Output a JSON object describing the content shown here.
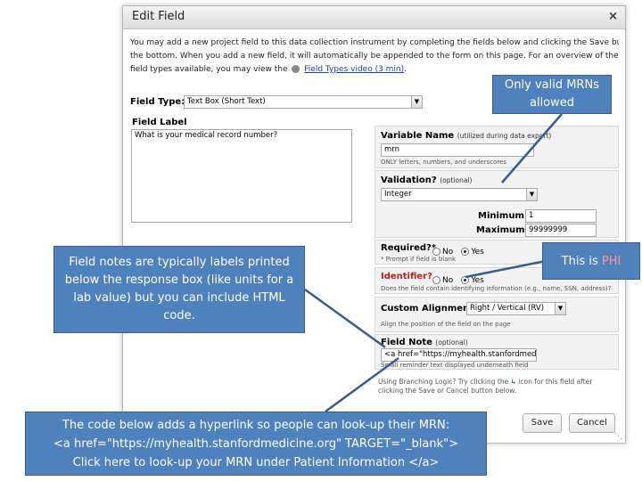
{
  "dialog": {
    "title": "Edit Field",
    "close_icon": "×",
    "intro_line1": "You may add a new project field to this data collection instrument by completing the fields below and clicking the Save button at",
    "intro_line2": "the bottom. When you add a new field, it will automatically be appended to the form on this page. For an overview of the different",
    "intro_line3_pre": "field types available, you may view the",
    "intro_link": "Field Types video (3 min)",
    "intro_line3_post": "."
  },
  "field_type": {
    "label": "Field Type:",
    "value": "Text Box (Short Text)"
  },
  "field_label": {
    "label": "Field Label",
    "value": "What is your medical record number?"
  },
  "variable_name": {
    "label": "Variable Name",
    "sublabel": "(utilized during data export)",
    "value": "mrn",
    "hint": "ONLY letters, numbers, and underscores"
  },
  "validation": {
    "label": "Validation?",
    "sublabel": "(optional)",
    "value": "Integer",
    "min_label": "Minimum:",
    "min_value": "1",
    "max_label": "Maximum:",
    "max_value": "99999999"
  },
  "required": {
    "label": "Required?*",
    "no": "No",
    "yes": "Yes",
    "hint": "* Prompt if field is blank"
  },
  "identifier": {
    "label": "Identifier?",
    "no": "No",
    "yes": "Yes",
    "hint": "Does the field contain identifying information (e.g., name, SSN, address)?"
  },
  "custom_alignment": {
    "label": "Custom Alignment",
    "value": "Right / Vertical (RV)",
    "hint": "Align the position of the field on the page"
  },
  "field_note": {
    "label": "Field Note",
    "sublabel": "(optional)",
    "value": "<a href=\"https://myhealth.stanfordmed",
    "hint": "Small reminder text displayed underneath field"
  },
  "branching": {
    "line1": "Using Branching Logic? Try clicking the",
    "line1_post": "icon for this field after",
    "line2": "clicking the Save or Cancel button below."
  },
  "buttons": {
    "save": "Save",
    "cancel": "Cancel"
  },
  "callouts": {
    "mrn": "Only valid MRNs allowed",
    "phi_pre": "This is ",
    "phi_word": "PHI",
    "notes": "Field notes are typically labels printed below the response box (like units for a lab value) but you can include HTML code.",
    "code_line1": "The code below adds a hyperlink so people can look-up their MRN:",
    "code_line2": "<a href=\"https://myhealth.stanfordmedicine.org\" TARGET=\"_blank\">",
    "code_line3": "Click here to look-up your MRN under Patient Information </a>"
  },
  "colors": {
    "callout_fill": "#4f81bd",
    "callout_text": "#ffffff",
    "phi_text": "#ff9999"
  }
}
